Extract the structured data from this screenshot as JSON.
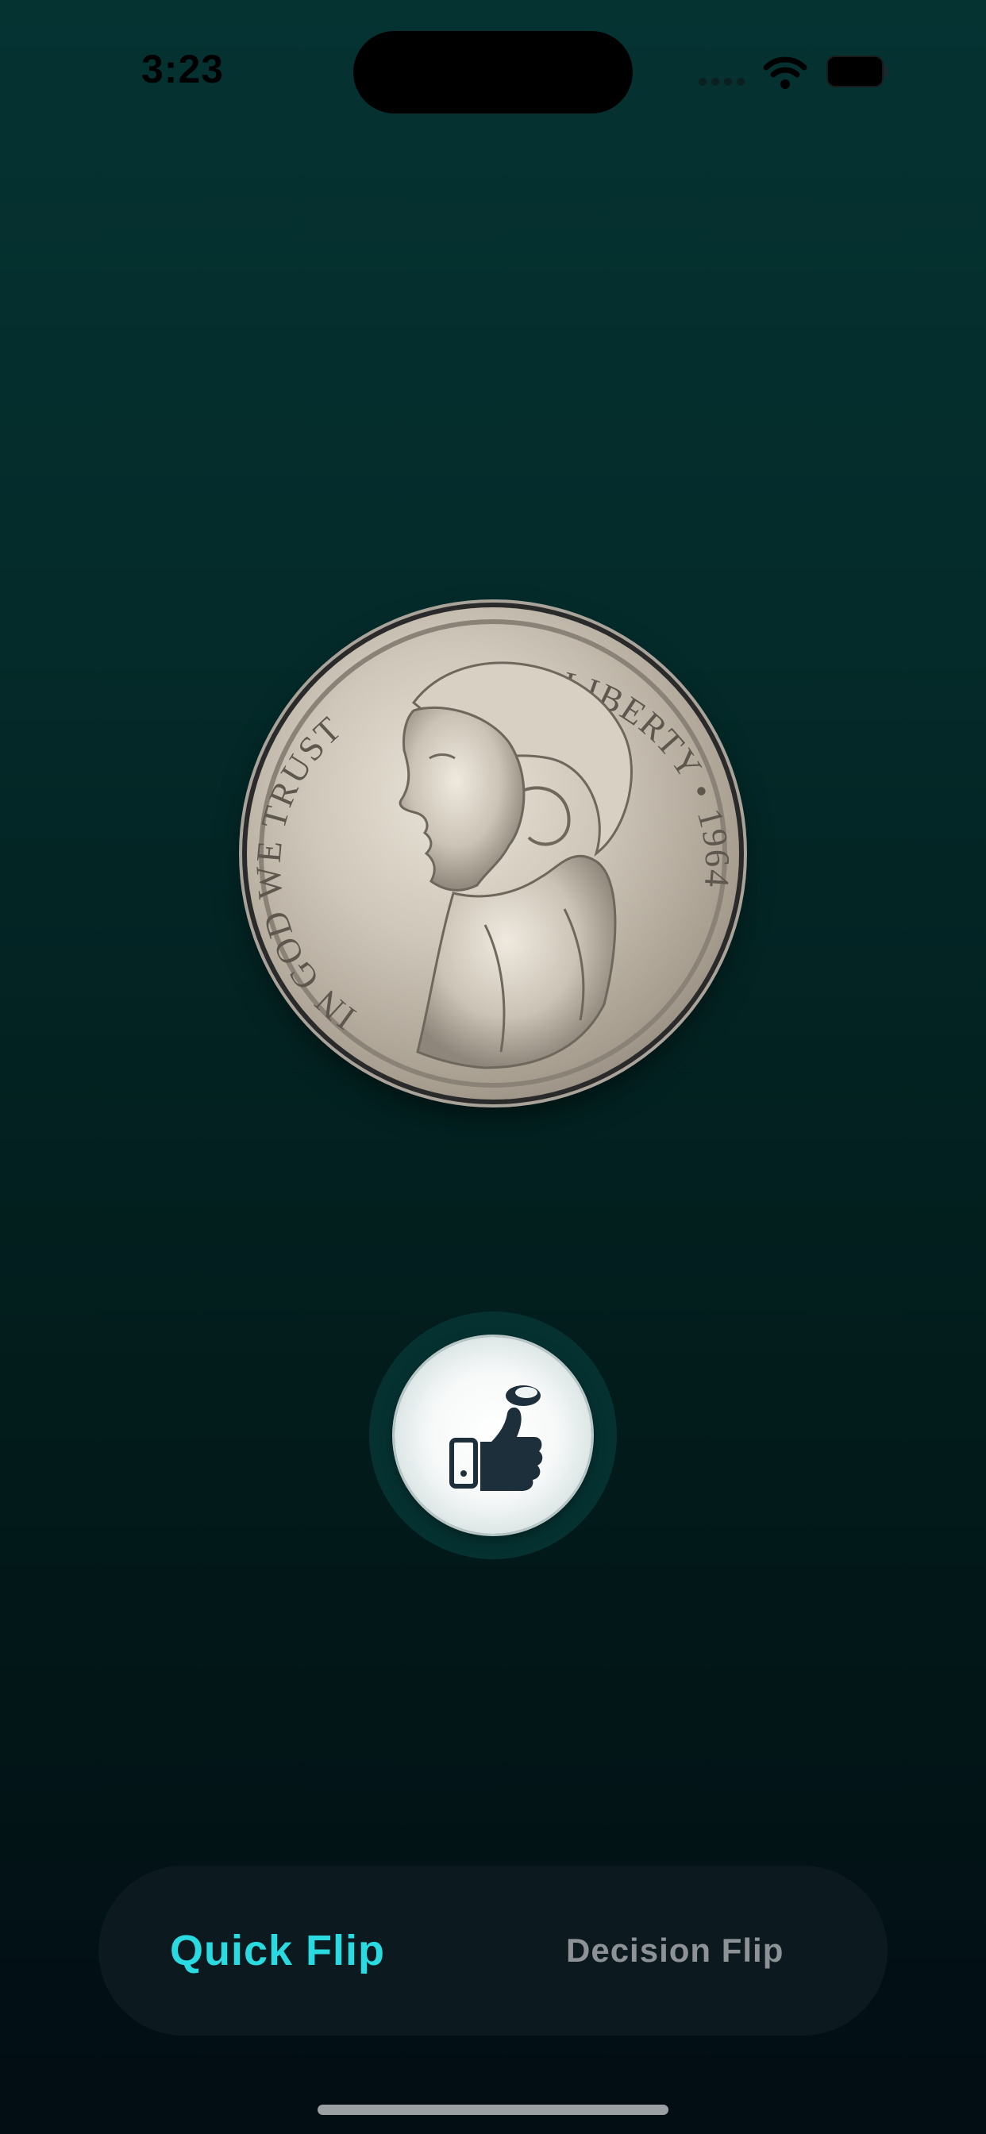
{
  "status_bar": {
    "time": "3:23",
    "icons": [
      "cellular-signal-icon",
      "wifi-icon",
      "battery-icon"
    ]
  },
  "coin": {
    "icon": "coin-icon",
    "description_icon": "jefferson-nickel-heads-icon",
    "inscriptions": [
      "IN GOD WE TRUST",
      "LIBERTY",
      "1964"
    ]
  },
  "flip_button": {
    "icon": "thumb-flip-coin-icon"
  },
  "mode_switcher": {
    "tabs": [
      {
        "label": "Quick Flip",
        "active": true
      },
      {
        "label": "Decision Flip",
        "active": false
      }
    ]
  },
  "colors": {
    "accent": "#29dbe0",
    "inactive_tab": "#8c9296",
    "background_top": "#053332",
    "background_bottom": "#020d14",
    "switcher_bg": "#0c1a1f"
  }
}
